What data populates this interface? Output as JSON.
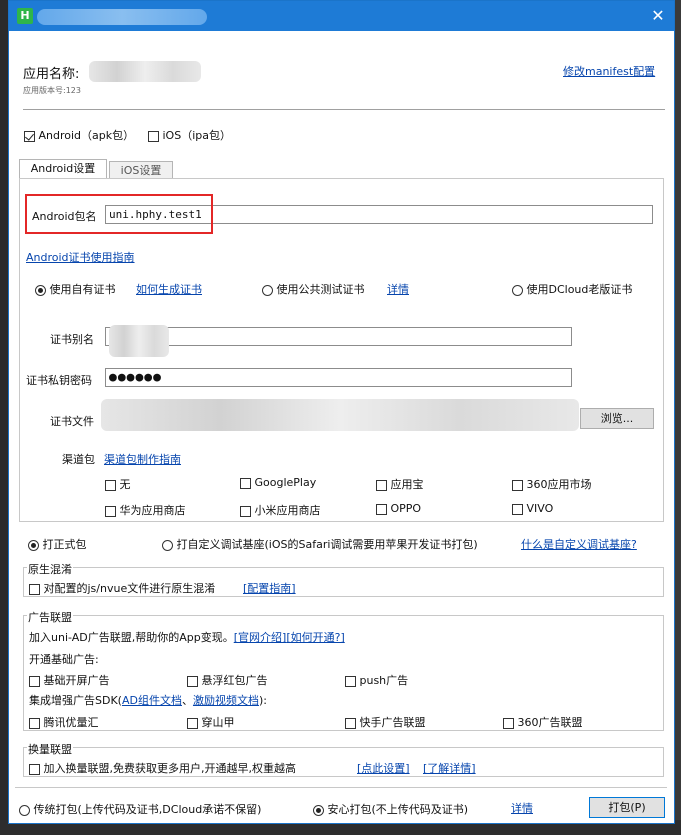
{
  "window": {
    "close_label": "✕"
  },
  "app": {
    "name_label": "应用名称:",
    "version_label": "应用版本号:",
    "version_value": "123",
    "edit_manifest": "修改manifest配置"
  },
  "platforms": {
    "android": "Android（apk包）",
    "ios": "iOS（ipa包）"
  },
  "tabs": {
    "android": "Android设置",
    "ios": "iOS设置"
  },
  "android": {
    "package_label": "Android包名",
    "package_value": "uni.hphy.test1",
    "cert_guide": "Android证书使用指南",
    "cert_own": "使用自有证书",
    "cert_howto": "如何生成证书",
    "cert_public": "使用公共测试证书",
    "cert_public_detail": "详情",
    "cert_dcloud": "使用DCloud老版证书",
    "alias_label": "证书别名",
    "password_label": "证书私钥密码",
    "password_value": "●●●●●●",
    "file_label": "证书文件",
    "browse": "浏览...",
    "channel_label": "渠道包",
    "channel_guide": "渠道包制作指南",
    "channels": [
      "无",
      "GooglePlay",
      "应用宝",
      "360应用市场",
      "华为应用商店",
      "小米应用商店",
      "OPPO",
      "VIVO"
    ]
  },
  "build_type": {
    "release": "打正式包",
    "custom": "打自定义调试基座(iOS的Safari调试需要用苹果开发证书打包)",
    "custom_link": "什么是自定义调试基座?"
  },
  "obfuscation": {
    "title": "原生混淆",
    "item": "对配置的js/nvue文件进行原生混淆",
    "guide": "[配置指南]"
  },
  "ads": {
    "title": "广告联盟",
    "intro": "加入uni-AD广告联盟,帮助你的App变现。",
    "link_official": "[官网介绍]",
    "link_howto": "[如何开通?]",
    "basic_title": "开通基础广告:",
    "basic": [
      "基础开屏广告",
      "悬浮红包广告",
      "push广告"
    ],
    "enhanced_prefix": "集成增强广告SDK(",
    "enhanced_link1": "AD组件文档",
    "enhanced_sep": "、",
    "enhanced_link2": "激励视频文档",
    "enhanced_suffix": "):",
    "enhanced": [
      "腾讯优量汇",
      "穿山甲",
      "快手广告联盟",
      "360广告联盟"
    ]
  },
  "exchange": {
    "title": "换量联盟",
    "item": "加入换量联盟,免费获取更多用户,开通越早,权重越高",
    "link_settings": "[点此设置]",
    "link_details": "[了解详情]"
  },
  "footer": {
    "traditional": "传统打包(上传代码及证书,DCloud承诺不保留)",
    "secure": "安心打包(不上传代码及证书)",
    "detail": "详情",
    "pack": "打包(P)"
  }
}
